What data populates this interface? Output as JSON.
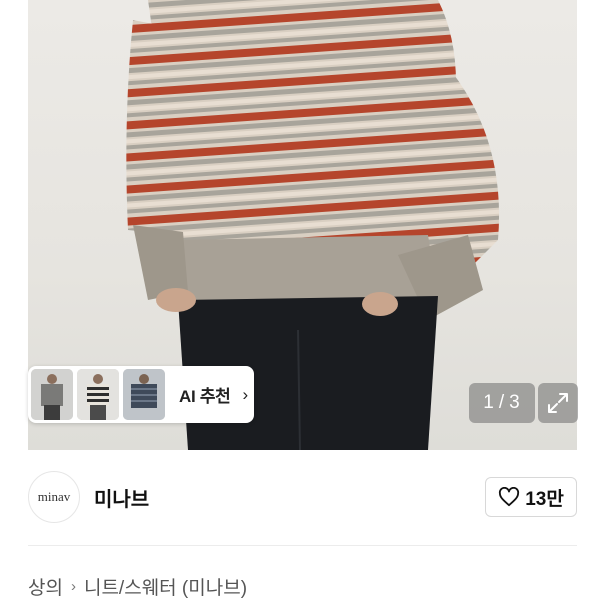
{
  "image_gallery": {
    "counter_current": "1",
    "counter_sep": "/",
    "counter_total": "3",
    "expand_icon": "expand-icon"
  },
  "ai_recommend": {
    "label": "AI 추천",
    "chevron": "›",
    "thumbnails": [
      "sweater-thumb-1",
      "sweater-thumb-2",
      "sweater-thumb-3"
    ]
  },
  "seller": {
    "avatar_text": "minav",
    "name": "미나브",
    "like_icon": "heart-icon",
    "like_count": "13만"
  },
  "breadcrumb": {
    "items": [
      "상의",
      "니트/스웨터 (미나브)"
    ],
    "separator": "›"
  },
  "colors": {
    "stripe_red": "#b5452c",
    "stripe_beige": "#d9cfc2",
    "stripe_grey": "#a8a49b",
    "pants": "#1a1c20"
  }
}
